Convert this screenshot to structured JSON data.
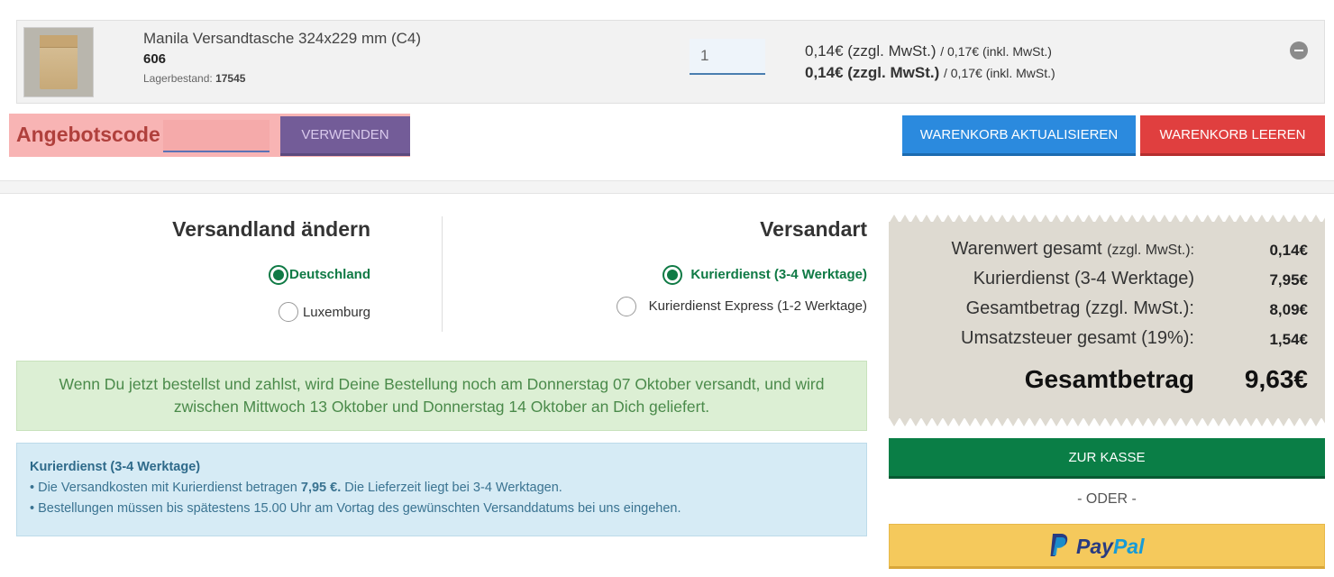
{
  "cart": {
    "item": {
      "name": "Manila Versandtasche 324x229 mm (C4)",
      "sku": "606",
      "stock_label": "Lagerbestand:",
      "stock_value": "17545",
      "quantity": "1",
      "unit_price_net": "0,14€ (zzgl. MwSt.)",
      "unit_price_gross": "/ 0,17€ (inkl. MwSt.)",
      "total_price_net": "0,14€ (zzgl. MwSt.)",
      "total_price_gross": "/ 0,17€ (inkl. MwSt.)",
      "remove_icon": "minus-circle-icon"
    },
    "coupon": {
      "label": "Angebotscode",
      "placeholder": "",
      "button": "VERWENDEN"
    },
    "update_button": "WARENKORB AKTUALISIEREN",
    "clear_button": "WARENKORB LEEREN"
  },
  "shipping": {
    "country_heading": "Versandland ändern",
    "countries": [
      {
        "label": "Deutschland",
        "selected": true
      },
      {
        "label": "Luxemburg",
        "selected": false
      }
    ],
    "method_heading": "Versandart",
    "methods": [
      {
        "label": "Kurierdienst (3-4 Werktage)",
        "selected": true
      },
      {
        "label": "Kurierdienst Express (1-2 Werktage)",
        "selected": false
      }
    ]
  },
  "delivery_notice": "Wenn Du jetzt bestellst und zahlst, wird Deine Bestellung noch am Donnerstag 07 Oktober versandt, und wird zwischen Mittwoch 13 Oktober und Donnerstag 14 Oktober an Dich geliefert.",
  "info": {
    "title": "Kurierdienst (3-4 Werktage)",
    "line1_pre": "• Die Versandkosten mit Kurierdienst betragen",
    "line1_bold": "7,95 €.",
    "line1_post": "Die Lieferzeit liegt bei 3-4 Werktagen.",
    "line2": "• Bestellungen müssen bis spätestens 15.00 Uhr am Vortag des gewünschten Versanddatums bei uns eingehen."
  },
  "summary": {
    "goods_label": "Warenwert gesamt",
    "goods_note": "(zzgl. MwSt.):",
    "goods_value": "0,14€",
    "shipping_label": "Kurierdienst (3-4 Werktage)",
    "shipping_value": "7,95€",
    "subtotal_label": "Gesamtbetrag (zzgl. MwSt.):",
    "subtotal_value": "8,09€",
    "tax_label": "Umsatzsteuer gesamt (19%):",
    "tax_value": "1,54€",
    "total_label": "Gesamtbetrag",
    "total_value": "9,63€"
  },
  "checkout_button": "ZUR KASSE",
  "or_text": "- ODER -",
  "paypal": {
    "pay": "Pay",
    "pal": "Pal",
    "icon": "paypal-icon"
  },
  "colors": {
    "primary_blue": "#2b8ade",
    "danger_red": "#e03f3f",
    "success_green": "#0a7e46",
    "coupon_purple": "#735c98",
    "paypal_yellow": "#f5c95c"
  }
}
